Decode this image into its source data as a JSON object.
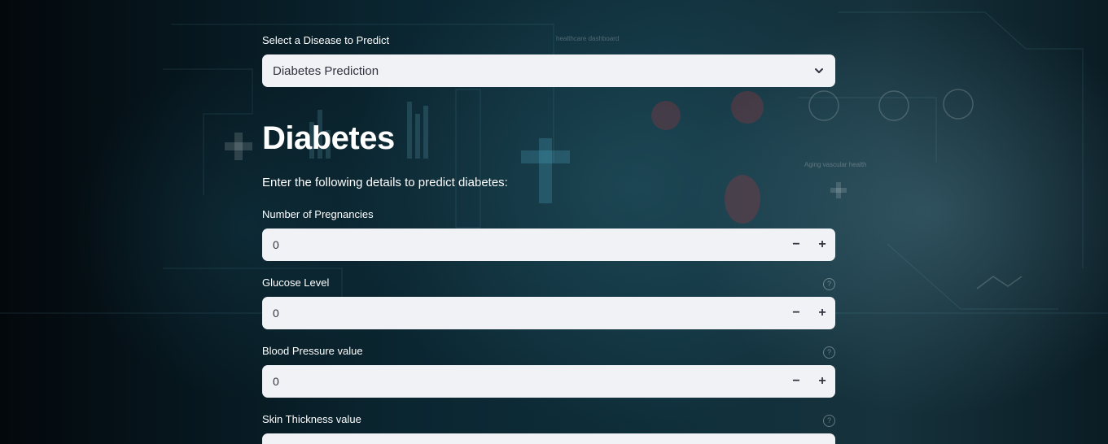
{
  "sidebar_select": {
    "label": "Select a Disease to Predict",
    "value": "Diabetes Prediction"
  },
  "page": {
    "title": "Diabetes",
    "subtitle": "Enter the following details to predict diabetes:"
  },
  "fields": [
    {
      "label": "Number of Pregnancies",
      "value": "0",
      "decrement": "−",
      "increment": "+"
    },
    {
      "label": "Glucose Level",
      "value": "0",
      "decrement": "−",
      "increment": "+"
    },
    {
      "label": "Blood Pressure value",
      "value": "0",
      "decrement": "−",
      "increment": "+"
    },
    {
      "label": "Skin Thickness value"
    }
  ],
  "help_icon_glyph": "?",
  "background": {
    "overlay_text": "healthcare dashboard",
    "overlay_text_2": "Aging vascular health"
  },
  "icons": {
    "select_chevron": "chevron-down-icon",
    "help": "question-circle-icon"
  },
  "colors": {
    "input_bg": "#f0f2f6",
    "input_text": "#31333f",
    "text": "#ffffff"
  }
}
